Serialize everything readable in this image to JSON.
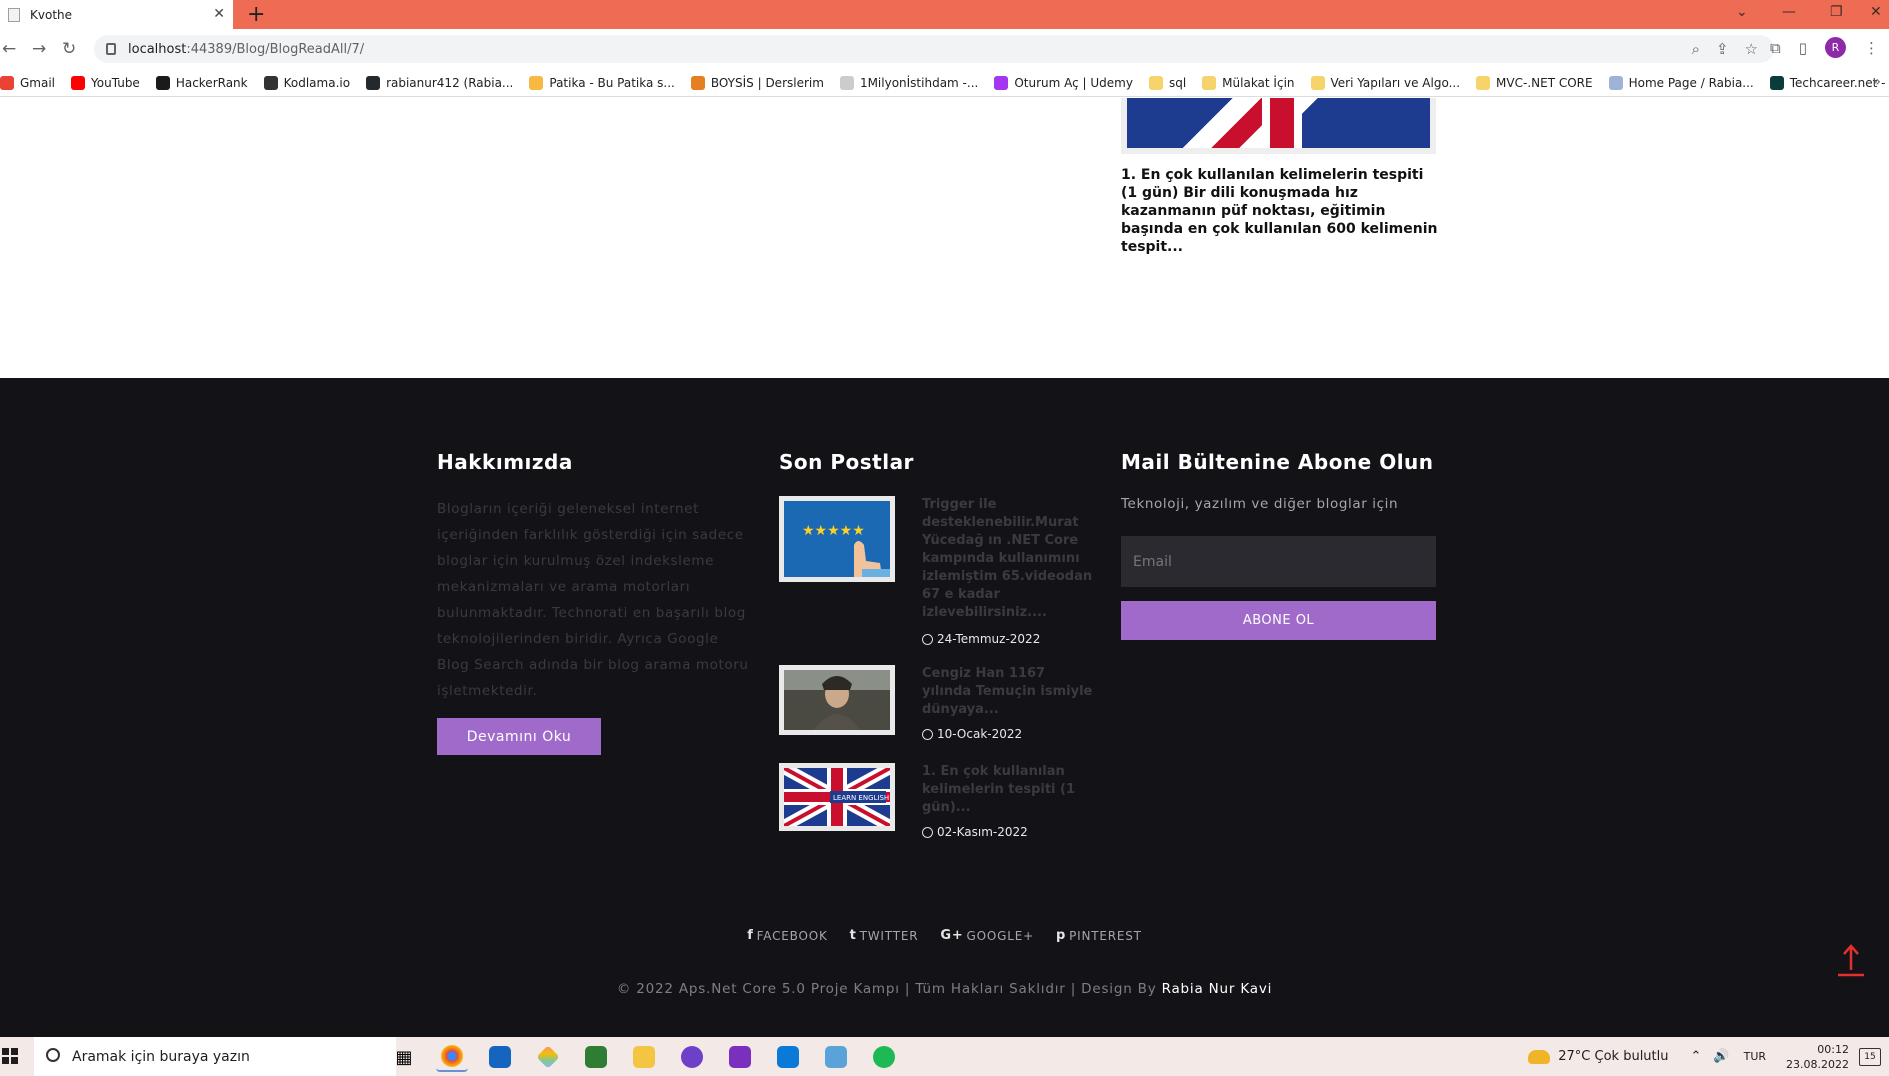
{
  "browser": {
    "tab_title": "Kvothe",
    "url_host": "localhost",
    "url_rest": ":44389/Blog/BlogReadAll/7/",
    "bookmarks": [
      {
        "label": "Gmail",
        "color": "#ea4335"
      },
      {
        "label": "YouTube",
        "color": "#ff0000"
      },
      {
        "label": "HackerRank",
        "color": "#1a1a1a"
      },
      {
        "label": "Kodlama.io",
        "color": "#333333"
      },
      {
        "label": "rabianur412 (Rabia...",
        "color": "#24292e"
      },
      {
        "label": "Patika - Bu Patika s...",
        "color": "#f7b844"
      },
      {
        "label": "BOYSİS | Derslerim",
        "color": "#e67e22"
      },
      {
        "label": "1Milyonİstihdam -...",
        "color": "#cccccc"
      },
      {
        "label": "Oturum Aç | Udemy",
        "color": "#a435f0"
      },
      {
        "label": "sql",
        "color": "#f6d46b"
      },
      {
        "label": "Mülakat İçin",
        "color": "#f6d46b"
      },
      {
        "label": "Veri Yapıları ve Algo...",
        "color": "#f6d46b"
      },
      {
        "label": "MVC-.NET CORE",
        "color": "#f6d46b"
      },
      {
        "label": "Home Page / Rabia...",
        "color": "#9fb3d9"
      },
      {
        "label": "Techcareer.net - Ha...",
        "color": "#0a3d3a"
      }
    ],
    "profile_initial": "R"
  },
  "page": {
    "excerpt": "1. En çok kullanılan kelimelerin tespiti (1 gün) Bir dili konuşmada hız kazanmanın püf noktası, eğitimin başında en çok kullanılan 600 kelimenin tespit..."
  },
  "footer": {
    "about": {
      "title": "Hakkımızda",
      "text": "Blogların içeriği geleneksel internet içeriğinden farklılık gösterdiği için sadece bloglar için kurulmuş özel indeksleme mekanizmaları ve arama motorları bulunmaktadır. Technorati en başarılı blog teknolojilerinden biridir. Ayrıca Google Blog Search adında bir blog arama motoru işletmektedir.",
      "button": "Devamını Oku"
    },
    "recent": {
      "title": "Son Postlar",
      "posts": [
        {
          "title": "Trigger ile desteklenebilir.Murat Yücedağ ın .NET Core kampında kullanımını izlemiştim 65.videodan 67 e kadar izleyebilirsiniz....",
          "date": "24-Temmuz-2022"
        },
        {
          "title": "Cengiz Han 1167 yılında Temuçin ismiyle dünyaya...",
          "date": "10-Ocak-2022"
        },
        {
          "title": "1. En çok kullanılan kelimelerin tespiti (1 gün)...",
          "date": "02-Kasım-2022"
        }
      ]
    },
    "newsletter": {
      "title": "Mail Bültenine Abone Olun",
      "subtitle": "Teknoloji, yazılım ve diğer bloglar için",
      "placeholder": "Email",
      "button": "ABONE OL"
    },
    "social": [
      {
        "icon": "facebook-icon",
        "glyph": "f",
        "label": "FACEBOOK"
      },
      {
        "icon": "twitter-icon",
        "glyph": "t",
        "label": "TWITTER"
      },
      {
        "icon": "google-plus-icon",
        "glyph": "G+",
        "label": "GOOGLE+"
      },
      {
        "icon": "pinterest-icon",
        "glyph": "p",
        "label": "PINTEREST"
      }
    ],
    "copyright": "© 2022 Aps.Net Core 5.0 Proje Kampı | Tüm Hakları Saklıdır | Design By ",
    "author": "Rabia Nur Kavi",
    "learn_english_label": "LEARN ENGLISH"
  },
  "taskbar": {
    "search_placeholder": "Aramak için buraya yazın",
    "weather": "27°C  Çok bulutlu",
    "lang": "TUR",
    "time": "00:12",
    "date": "23.08.2022",
    "notif_count": "15"
  }
}
